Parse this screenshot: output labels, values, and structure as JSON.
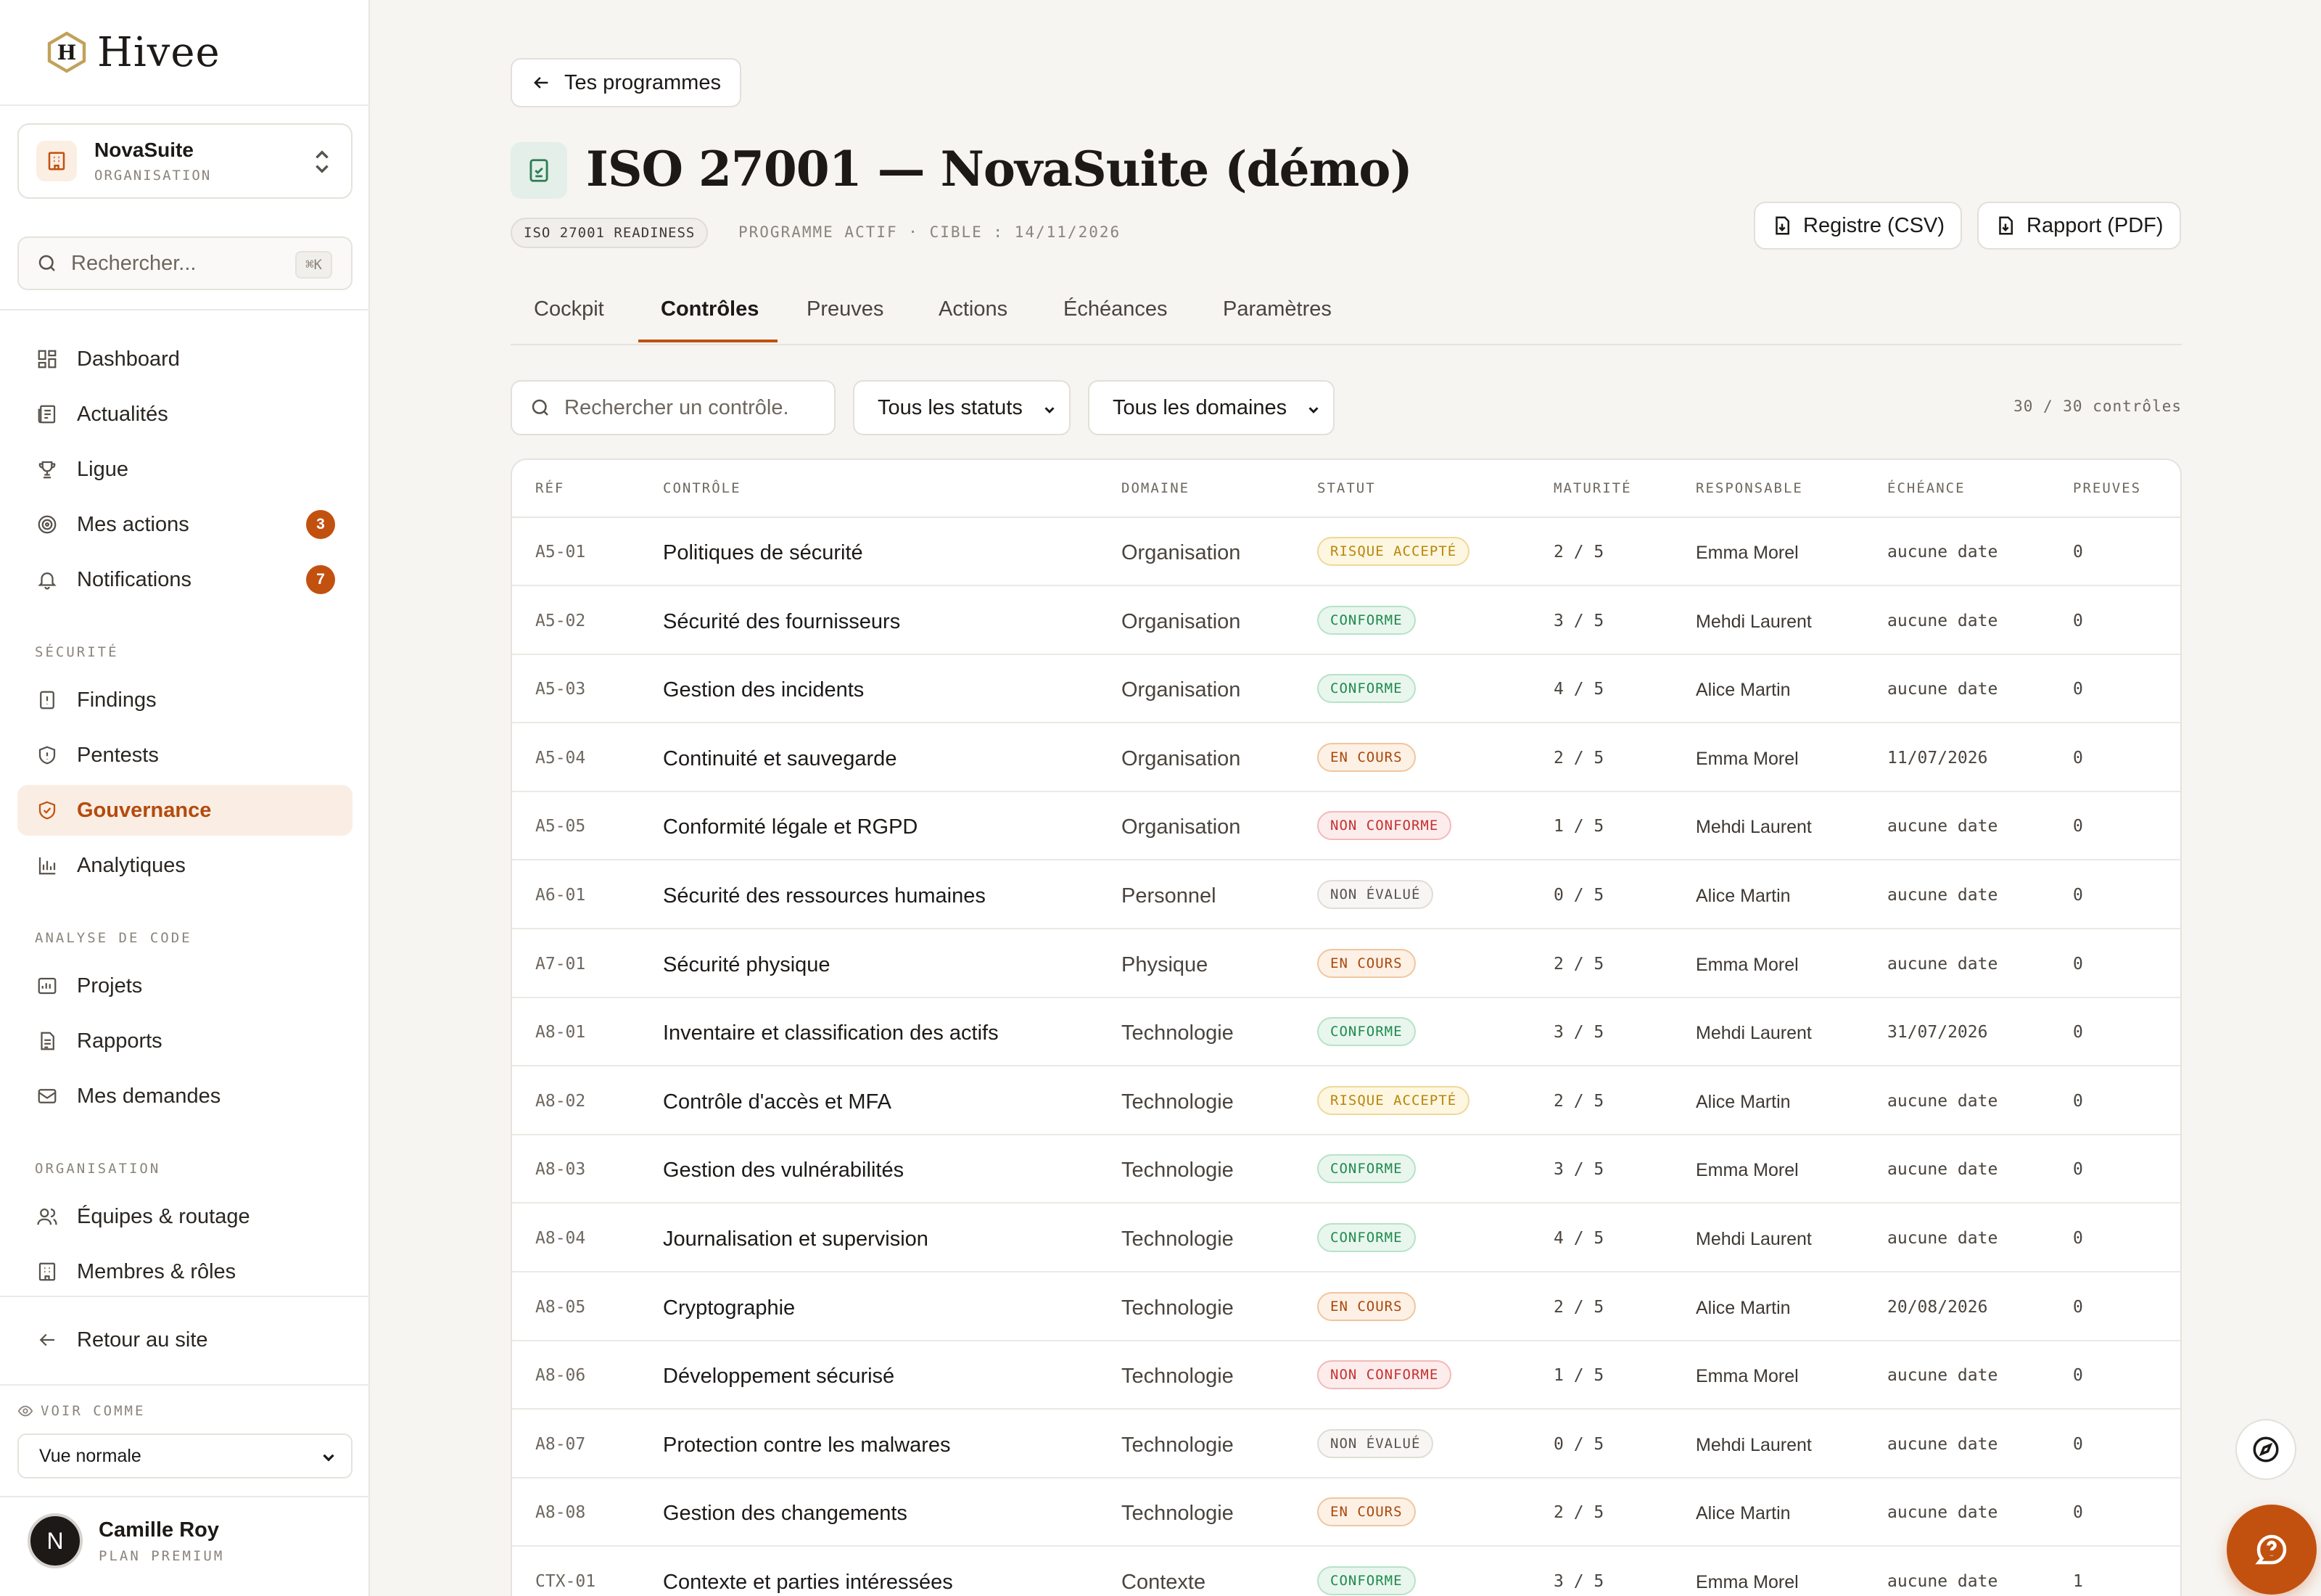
{
  "brand": {
    "name": "Hivee",
    "accent": "#c2510f"
  },
  "org_switcher": {
    "name": "NovaSuite",
    "sub": "ORGANISATION"
  },
  "sidebar_search": {
    "placeholder": "Rechercher...",
    "shortcut": "⌘K"
  },
  "nav": {
    "main": [
      {
        "label": "Dashboard",
        "icon": "dashboard-icon"
      },
      {
        "label": "Actualités",
        "icon": "newspaper-icon"
      },
      {
        "label": "Ligue",
        "icon": "trophy-icon"
      },
      {
        "label": "Mes actions",
        "icon": "target-icon",
        "badge": "3"
      },
      {
        "label": "Notifications",
        "icon": "bell-icon",
        "badge": "7"
      }
    ],
    "security_label": "SÉCURITÉ",
    "security": [
      {
        "label": "Findings",
        "icon": "file-alert-icon"
      },
      {
        "label": "Pentests",
        "icon": "shield-icon"
      },
      {
        "label": "Gouvernance",
        "icon": "shield-check-icon",
        "active": true
      },
      {
        "label": "Analytiques",
        "icon": "bar-chart-icon"
      }
    ],
    "code_label": "ANALYSE DE CODE",
    "code": [
      {
        "label": "Projets",
        "icon": "folder-icon"
      },
      {
        "label": "Rapports",
        "icon": "document-icon"
      },
      {
        "label": "Mes demandes",
        "icon": "inbox-icon"
      }
    ],
    "org_label": "ORGANISATION",
    "org": [
      {
        "label": "Équipes & routage",
        "icon": "users-icon"
      },
      {
        "label": "Membres & rôles",
        "icon": "building-icon"
      }
    ],
    "back_to_site": "Retour au site"
  },
  "view_as": {
    "label": "VOIR COMME",
    "value": "Vue normale"
  },
  "user": {
    "initial": "N",
    "name": "Camille Roy",
    "plan": "PLAN PREMIUM"
  },
  "header": {
    "back_label": "Tes programmes",
    "title": "ISO 27001 — NovaSuite (démo)",
    "tag": "ISO 27001 READINESS",
    "meta": "PROGRAMME ACTIF · CIBLE : 14/11/2026",
    "export_csv": "Registre (CSV)",
    "export_pdf": "Rapport (PDF)"
  },
  "tabs": [
    {
      "label": "Cockpit"
    },
    {
      "label": "Contrôles",
      "active": true
    },
    {
      "label": "Preuves"
    },
    {
      "label": "Actions"
    },
    {
      "label": "Échéances"
    },
    {
      "label": "Paramètres"
    }
  ],
  "filters": {
    "search_placeholder": "Rechercher un contrôle.",
    "status_value": "Tous les statuts",
    "domain_value": "Tous les domaines",
    "count": "30 / 30 contrôles"
  },
  "table": {
    "columns": [
      "RÉF",
      "CONTRÔLE",
      "DOMAINE",
      "STATUT",
      "MATURITÉ",
      "RESPONSABLE",
      "ÉCHÉANCE",
      "PREUVES"
    ],
    "rows": [
      {
        "ref": "A5-01",
        "control": "Politiques de sécurité",
        "domain": "Organisation",
        "status": "RISQUE ACCEPTÉ",
        "status_kind": "risque",
        "maturity": "2 / 5",
        "owner": "Emma Morel",
        "due": "aucune date",
        "proofs": "0"
      },
      {
        "ref": "A5-02",
        "control": "Sécurité des fournisseurs",
        "domain": "Organisation",
        "status": "CONFORME",
        "status_kind": "conforme",
        "maturity": "3 / 5",
        "owner": "Mehdi Laurent",
        "due": "aucune date",
        "proofs": "0"
      },
      {
        "ref": "A5-03",
        "control": "Gestion des incidents",
        "domain": "Organisation",
        "status": "CONFORME",
        "status_kind": "conforme",
        "maturity": "4 / 5",
        "owner": "Alice Martin",
        "due": "aucune date",
        "proofs": "0"
      },
      {
        "ref": "A5-04",
        "control": "Continuité et sauvegarde",
        "domain": "Organisation",
        "status": "EN COURS",
        "status_kind": "encours",
        "maturity": "2 / 5",
        "owner": "Emma Morel",
        "due": "11/07/2026",
        "proofs": "0"
      },
      {
        "ref": "A5-05",
        "control": "Conformité légale et RGPD",
        "domain": "Organisation",
        "status": "NON CONFORME",
        "status_kind": "nonconf",
        "maturity": "1 / 5",
        "owner": "Mehdi Laurent",
        "due": "aucune date",
        "proofs": "0"
      },
      {
        "ref": "A6-01",
        "control": "Sécurité des ressources humaines",
        "domain": "Personnel",
        "status": "NON ÉVALUÉ",
        "status_kind": "noneval",
        "maturity": "0 / 5",
        "owner": "Alice Martin",
        "due": "aucune date",
        "proofs": "0"
      },
      {
        "ref": "A7-01",
        "control": "Sécurité physique",
        "domain": "Physique",
        "status": "EN COURS",
        "status_kind": "encours",
        "maturity": "2 / 5",
        "owner": "Emma Morel",
        "due": "aucune date",
        "proofs": "0"
      },
      {
        "ref": "A8-01",
        "control": "Inventaire et classification des actifs",
        "domain": "Technologie",
        "status": "CONFORME",
        "status_kind": "conforme",
        "maturity": "3 / 5",
        "owner": "Mehdi Laurent",
        "due": "31/07/2026",
        "proofs": "0"
      },
      {
        "ref": "A8-02",
        "control": "Contrôle d'accès et MFA",
        "domain": "Technologie",
        "status": "RISQUE ACCEPTÉ",
        "status_kind": "risque",
        "maturity": "2 / 5",
        "owner": "Alice Martin",
        "due": "aucune date",
        "proofs": "0"
      },
      {
        "ref": "A8-03",
        "control": "Gestion des vulnérabilités",
        "domain": "Technologie",
        "status": "CONFORME",
        "status_kind": "conforme",
        "maturity": "3 / 5",
        "owner": "Emma Morel",
        "due": "aucune date",
        "proofs": "0"
      },
      {
        "ref": "A8-04",
        "control": "Journalisation et supervision",
        "domain": "Technologie",
        "status": "CONFORME",
        "status_kind": "conforme",
        "maturity": "4 / 5",
        "owner": "Mehdi Laurent",
        "due": "aucune date",
        "proofs": "0"
      },
      {
        "ref": "A8-05",
        "control": "Cryptographie",
        "domain": "Technologie",
        "status": "EN COURS",
        "status_kind": "encours",
        "maturity": "2 / 5",
        "owner": "Alice Martin",
        "due": "20/08/2026",
        "proofs": "0"
      },
      {
        "ref": "A8-06",
        "control": "Développement sécurisé",
        "domain": "Technologie",
        "status": "NON CONFORME",
        "status_kind": "nonconf",
        "maturity": "1 / 5",
        "owner": "Emma Morel",
        "due": "aucune date",
        "proofs": "0"
      },
      {
        "ref": "A8-07",
        "control": "Protection contre les malwares",
        "domain": "Technologie",
        "status": "NON ÉVALUÉ",
        "status_kind": "noneval",
        "maturity": "0 / 5",
        "owner": "Mehdi Laurent",
        "due": "aucune date",
        "proofs": "0"
      },
      {
        "ref": "A8-08",
        "control": "Gestion des changements",
        "domain": "Technologie",
        "status": "EN COURS",
        "status_kind": "encours",
        "maturity": "2 / 5",
        "owner": "Alice Martin",
        "due": "aucune date",
        "proofs": "0"
      },
      {
        "ref": "CTX-01",
        "control": "Contexte et parties intéressées",
        "domain": "Contexte",
        "status": "CONFORME",
        "status_kind": "conforme",
        "maturity": "3 / 5",
        "owner": "Emma Morel",
        "due": "aucune date",
        "proofs": "1"
      }
    ]
  }
}
